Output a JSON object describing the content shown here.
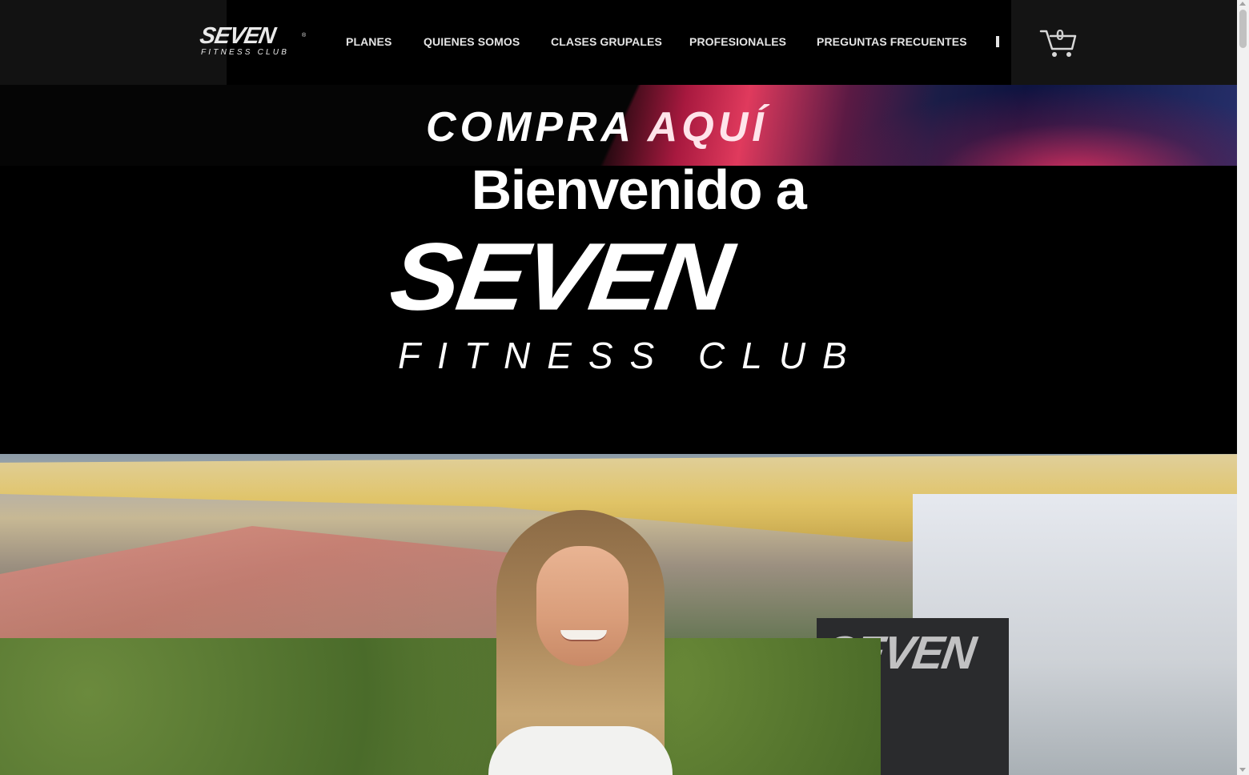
{
  "header": {
    "logo": {
      "word": "SEVEN",
      "sub": "FITNESS CLUB",
      "reg": "®"
    },
    "nav": [
      {
        "label": "PLANES"
      },
      {
        "label": "QUIENES SOMOS"
      },
      {
        "label": "CLASES GRUPALES"
      },
      {
        "label": "PROFESIONALES"
      },
      {
        "label": "PREGUNTAS FRECUENTES"
      }
    ],
    "cart": {
      "count": "0",
      "icon": "cart-icon"
    }
  },
  "banner": {
    "word1": "COMPRA",
    "word2": "AQUÍ"
  },
  "hero": {
    "welcome": "Bienvenido a",
    "logo_word": "SEVEN",
    "logo_sub": "FITNESS CLUB"
  },
  "photo": {
    "flag_text": "SEVEN"
  },
  "colors": {
    "background": "#000000",
    "nav_text": "#e4e4e4",
    "banner_accent_pink": "#e03a5d",
    "banner_accent_navy": "#1b1d47"
  }
}
